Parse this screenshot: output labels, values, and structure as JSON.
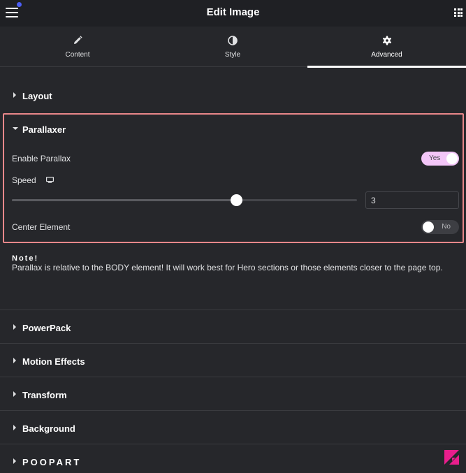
{
  "header": {
    "title": "Edit Image"
  },
  "tabs": [
    {
      "label": "Content",
      "icon": "pencil-icon"
    },
    {
      "label": "Style",
      "icon": "contrast-icon"
    },
    {
      "label": "Advanced",
      "icon": "gear-icon",
      "active": true
    }
  ],
  "sections": {
    "layout": "Layout",
    "parallaxer": "Parallaxer",
    "powerpack": "PowerPack",
    "motion_effects": "Motion Effects",
    "transform": "Transform",
    "background": "Background",
    "poopart": "POOPART"
  },
  "parallaxer": {
    "enable_label": "Enable Parallax",
    "enable_toggle": "Yes",
    "speed_label": "Speed",
    "speed_value": "3",
    "speed_fraction": 0.65,
    "center_label": "Center Element",
    "center_toggle": "No"
  },
  "note": {
    "title": "Note!",
    "text": "Parallax is relative to the BODY element! It will work best for Hero sections or those elements closer to the page top."
  },
  "colors": {
    "header_bg": "#1f2024",
    "panel_bg": "#26272b",
    "highlight_border": "#e8878a",
    "toggle_on": "#f3c6f8",
    "brand_pink": "#e91e8c"
  }
}
